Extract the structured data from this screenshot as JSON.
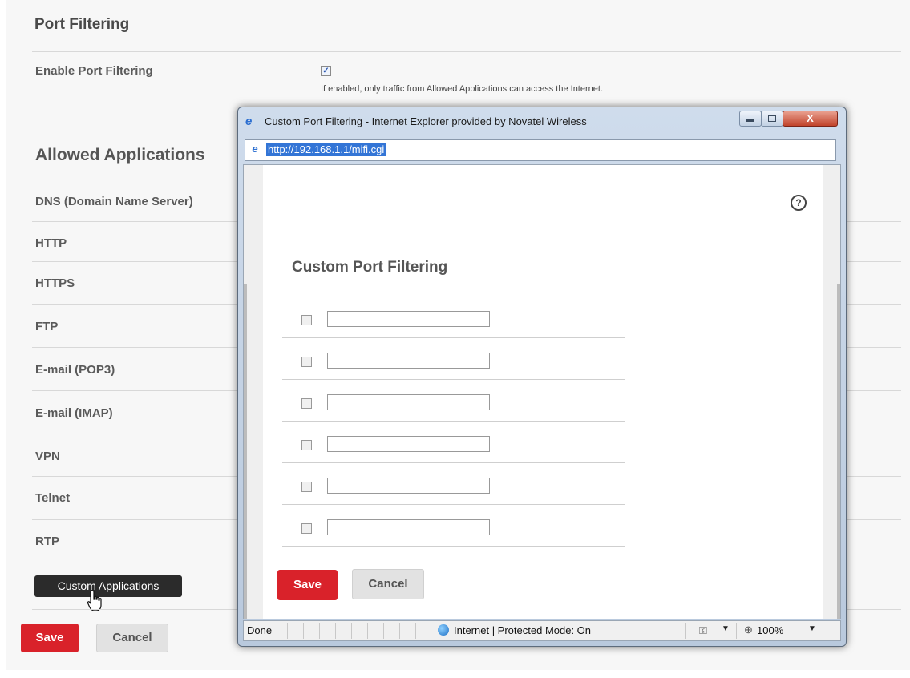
{
  "page": {
    "title": "Port Filtering",
    "enable_label": "Enable Port Filtering",
    "enable_checked": true,
    "enable_note": "If enabled, only traffic from Allowed Applications can access the Internet.",
    "allowed_title": "Allowed Applications",
    "apps": [
      "DNS (Domain Name Server)",
      "HTTP",
      "HTTPS",
      "FTP",
      "E-mail (POP3)",
      "E-mail (IMAP)",
      "VPN",
      "Telnet",
      "RTP"
    ],
    "custom_apps_label": "Custom Applications",
    "save_label": "Save",
    "cancel_label": "Cancel"
  },
  "popup": {
    "window_title": "Custom Port Filtering - Internet Explorer provided by Novatel Wireless",
    "close_label": "X",
    "address_url": "http://192.168.1.1/mifi.cgi",
    "help_label": "?",
    "heading": "Custom Port Filtering",
    "rows": [
      {
        "checked": false,
        "value": ""
      },
      {
        "checked": false,
        "value": ""
      },
      {
        "checked": false,
        "value": ""
      },
      {
        "checked": false,
        "value": ""
      },
      {
        "checked": false,
        "value": ""
      },
      {
        "checked": false,
        "value": ""
      }
    ],
    "save_label": "Save",
    "cancel_label": "Cancel",
    "status": {
      "left_text": "Done",
      "zone_text": "Internet | Protected Mode: On",
      "zoom_text": "100%"
    }
  },
  "colors": {
    "accent_red": "#d9222a",
    "dark_button": "#2b2b2b",
    "url_highlight": "#3375d6"
  },
  "icons": [
    "ie-logo-icon",
    "minimize-icon",
    "maximize-icon",
    "close-icon",
    "help-icon",
    "globe-icon",
    "lock-icon",
    "zoom-icon",
    "hand-cursor-icon"
  ]
}
